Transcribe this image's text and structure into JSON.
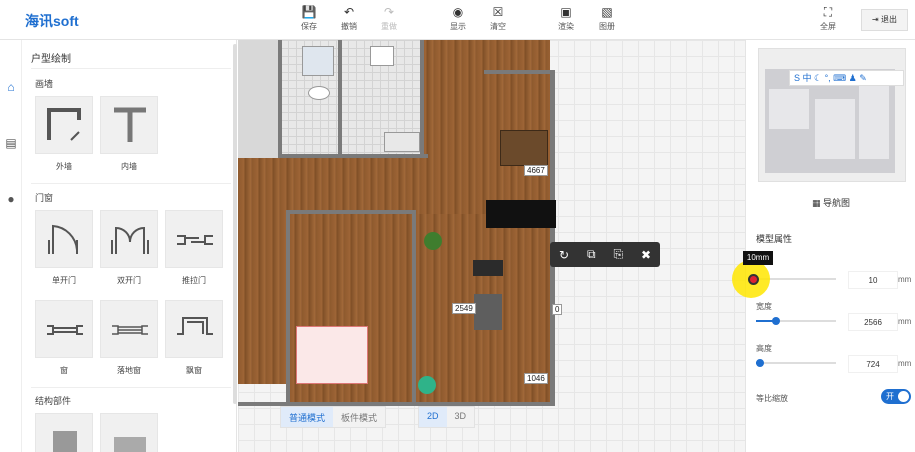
{
  "app": {
    "logo": "海讯soft"
  },
  "toolbar": {
    "save": "保存",
    "undo": "撤销",
    "redo": "重做",
    "display": "显示",
    "clear": "清空",
    "render": "渲染",
    "floorplan": "图册",
    "fullscreen": "全屏",
    "exit": "退出"
  },
  "left_panel": {
    "title": "户型绘制",
    "sections": {
      "walls": {
        "label": "画墙",
        "items": [
          "外墙",
          "内墙"
        ]
      },
      "doors": {
        "label": "门窗",
        "items": [
          "单开门",
          "双开门",
          "推拉门",
          "窗",
          "落地窗",
          "飘窗"
        ]
      },
      "structure": {
        "label": "结构部件"
      }
    }
  },
  "canvas": {
    "dimensions": [
      "4667",
      "2549",
      "0",
      "1046"
    ],
    "modes": [
      "普通模式",
      "板件模式"
    ],
    "view_modes": [
      "2D",
      "3D"
    ],
    "active_mode": "普通模式",
    "active_view": "2D"
  },
  "right_panel": {
    "navmap_label": "导航图",
    "properties_title": "模型属性",
    "tooltip": "10mm",
    "props": [
      {
        "label": "",
        "value": "10",
        "unit": "mm",
        "level": 0.02
      },
      {
        "label": "宽度",
        "value": "2566",
        "unit": "mm",
        "level": 0.25
      },
      {
        "label": "高度",
        "value": "724",
        "unit": "mm",
        "level": 0.05
      }
    ],
    "proportional_label": "等比缩放",
    "toggle_label": "开"
  },
  "ime_bar": "S 中 ☾ °, ⌨ ♟ ✎",
  "colors": {
    "accent": "#1f6fd0",
    "highlight": "#ffe600"
  }
}
